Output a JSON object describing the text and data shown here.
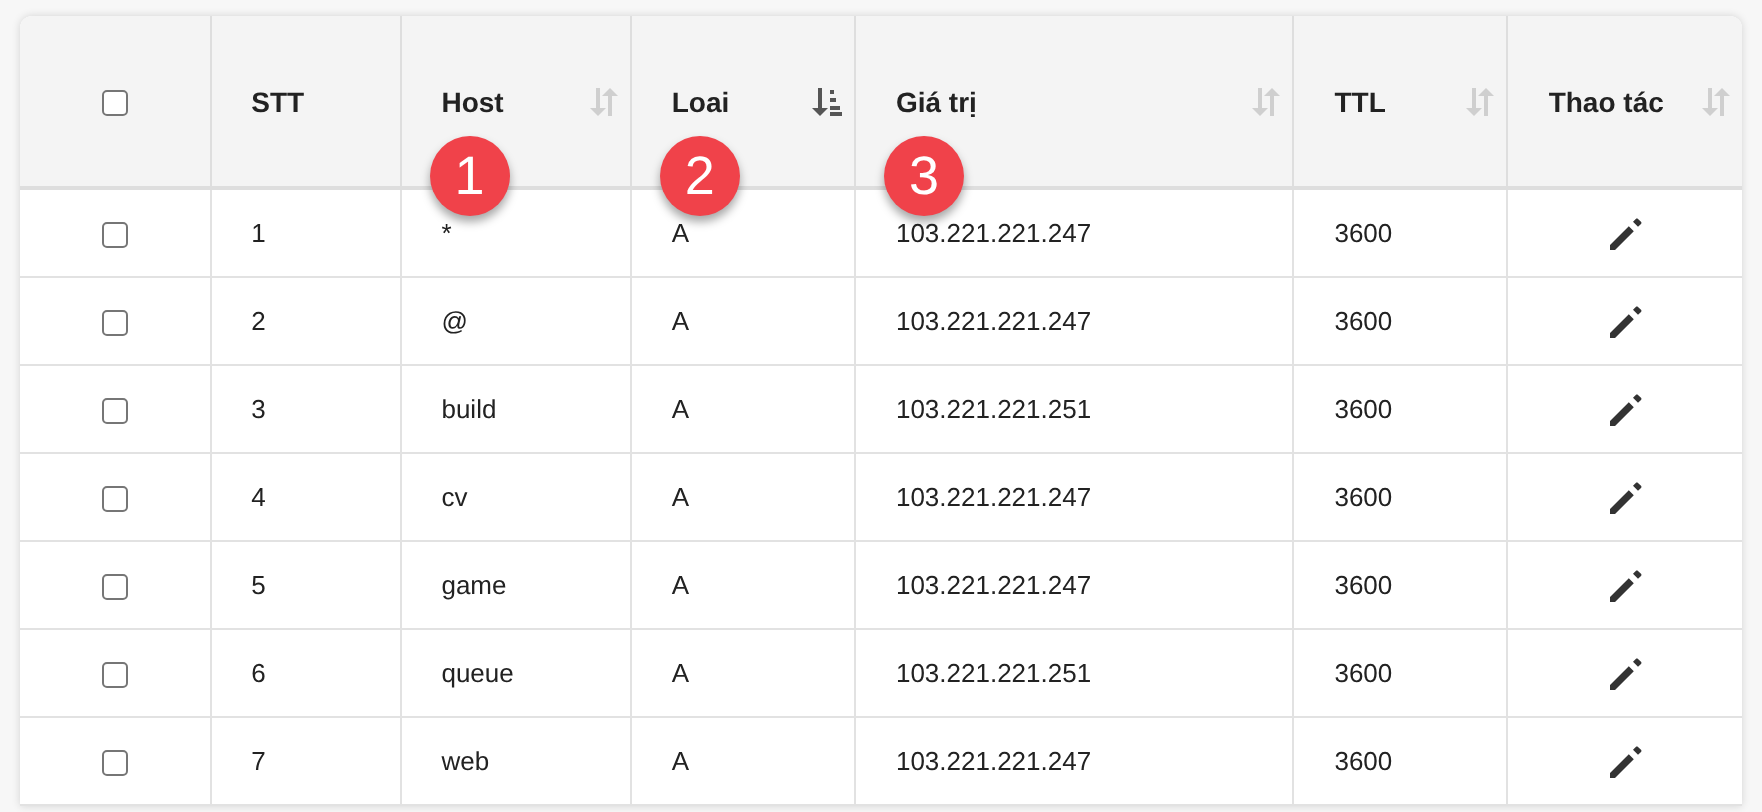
{
  "table": {
    "select_all": {
      "checked": false
    },
    "columns": [
      {
        "label": "STT"
      },
      {
        "label": "Host",
        "sorted": false,
        "badge": "1"
      },
      {
        "label": "Loai",
        "sorted": true,
        "badge": "2"
      },
      {
        "label": "Giá trị",
        "sorted": false,
        "badge": "3"
      },
      {
        "label": "TTL",
        "sorted": false
      },
      {
        "label": "Thao tác",
        "sorted": false
      }
    ],
    "rows": [
      {
        "checked": false,
        "stt": "1",
        "host": "*",
        "type": "A",
        "value": "103.221.221.247",
        "ttl": "3600"
      },
      {
        "checked": false,
        "stt": "2",
        "host": "@",
        "type": "A",
        "value": "103.221.221.247",
        "ttl": "3600"
      },
      {
        "checked": false,
        "stt": "3",
        "host": "build",
        "type": "A",
        "value": "103.221.221.251",
        "ttl": "3600"
      },
      {
        "checked": false,
        "stt": "4",
        "host": "cv",
        "type": "A",
        "value": "103.221.221.247",
        "ttl": "3600"
      },
      {
        "checked": false,
        "stt": "5",
        "host": "game",
        "type": "A",
        "value": "103.221.221.247",
        "ttl": "3600"
      },
      {
        "checked": false,
        "stt": "6",
        "host": "queue",
        "type": "A",
        "value": "103.221.221.251",
        "ttl": "3600"
      },
      {
        "checked": false,
        "stt": "7",
        "host": "web",
        "type": "A",
        "value": "103.221.221.247",
        "ttl": "3600"
      }
    ]
  }
}
